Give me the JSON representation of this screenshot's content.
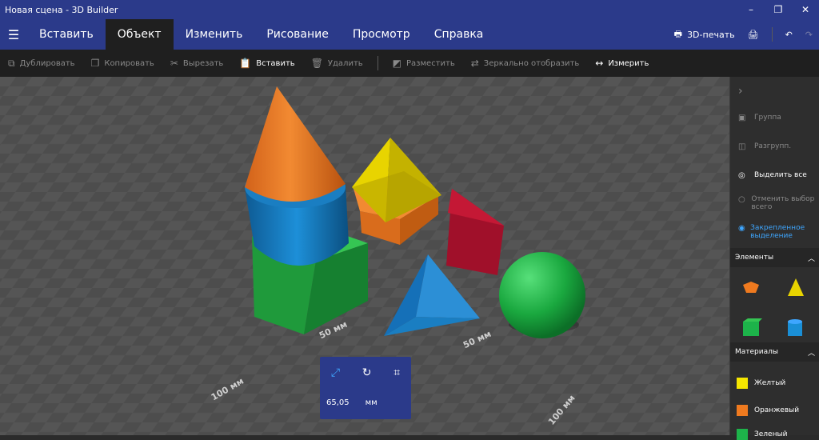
{
  "window": {
    "title": "Новая сцена - 3D Builder",
    "minimize": "–",
    "maximize": "❐",
    "close": "✕"
  },
  "menu": {
    "tabs": [
      {
        "label": "Вставить"
      },
      {
        "label": "Объект"
      },
      {
        "label": "Изменить"
      },
      {
        "label": "Рисование"
      },
      {
        "label": "Просмотр"
      },
      {
        "label": "Справка"
      }
    ],
    "print3d_label": "3D-печать"
  },
  "toolbar": {
    "duplicate": "Дублировать",
    "copy": "Копировать",
    "cut": "Вырезать",
    "paste": "Вставить",
    "delete": "Удалить",
    "place": "Разместить",
    "mirror": "Зеркально отобразить",
    "measure": "Измерить"
  },
  "panel": {
    "group": "Группа",
    "ungroup": "Разгрупп.",
    "select_all": "Выделить все",
    "deselect_all": "Отменить выбор всего",
    "pinned_select": "Закрепленное выделение",
    "elements_header": "Элементы",
    "materials_header": "Материалы",
    "materials": [
      {
        "label": "Желтый",
        "color": "#f5e600"
      },
      {
        "label": "Оранжевый",
        "color": "#ef7a1f"
      },
      {
        "label": "Зеленый",
        "color": "#1db34a"
      }
    ]
  },
  "measure": {
    "value": "65,05",
    "unit": "мм"
  },
  "dimensions": {
    "a": "50 мм",
    "b": "50 мм",
    "c": "100 мм",
    "d": "100 мм"
  },
  "colors": {
    "accent": "#2b3a8a",
    "highlight": "#3ea6ff"
  }
}
